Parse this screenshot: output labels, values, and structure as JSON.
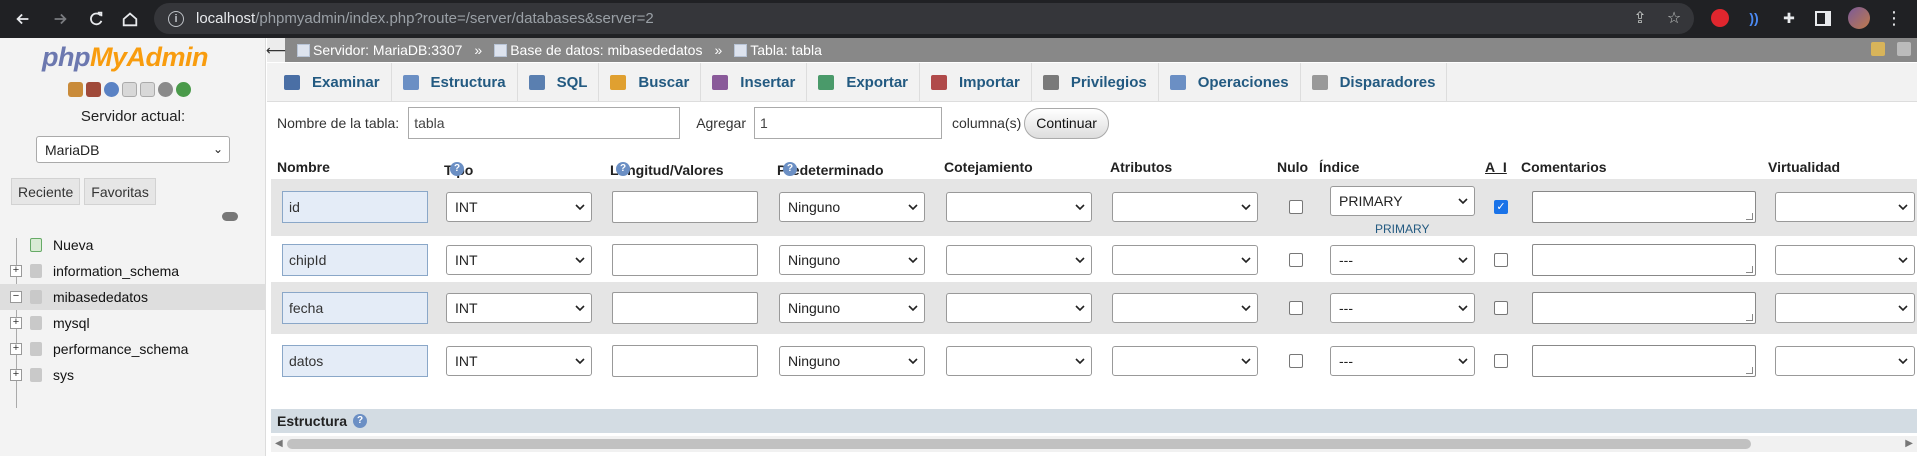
{
  "browser": {
    "url_host": "localhost",
    "url_path": "/phpmyadmin/index.php?route=/server/databases&server=2"
  },
  "sidebar": {
    "logo_php": "php",
    "logo_my": "MyAdmin",
    "server_label": "Servidor actual:",
    "server_selected": "MariaDB",
    "recent_label": "Reciente",
    "favorites_label": "Favoritas",
    "tree": [
      {
        "label": "Nueva",
        "type": "new"
      },
      {
        "label": "information_schema",
        "type": "db"
      },
      {
        "label": "mibasededatos",
        "type": "db",
        "selected": true
      },
      {
        "label": "mysql",
        "type": "db"
      },
      {
        "label": "performance_schema",
        "type": "db"
      },
      {
        "label": "sys",
        "type": "db"
      }
    ]
  },
  "breadcrumb": {
    "server": "Servidor: MariaDB:3307",
    "database": "Base de datos: mibasededatos",
    "table": "Tabla: tabla",
    "separator": "»"
  },
  "tabs": [
    {
      "label": "Examinar",
      "icon": "browse-icon",
      "color": "#4a6fa5"
    },
    {
      "label": "Estructura",
      "icon": "structure-icon",
      "color": "#6b8fc4"
    },
    {
      "label": "SQL",
      "icon": "sql-icon",
      "color": "#5a7fb0"
    },
    {
      "label": "Buscar",
      "icon": "search-icon",
      "color": "#e0a030"
    },
    {
      "label": "Insertar",
      "icon": "insert-icon",
      "color": "#8a5a9a"
    },
    {
      "label": "Exportar",
      "icon": "export-icon",
      "color": "#4a9a6a"
    },
    {
      "label": "Importar",
      "icon": "import-icon",
      "color": "#b04a4a"
    },
    {
      "label": "Privilegios",
      "icon": "privileges-icon",
      "color": "#7a7a7a"
    },
    {
      "label": "Operaciones",
      "icon": "operations-icon",
      "color": "#6b8fc4"
    },
    {
      "label": "Disparadores",
      "icon": "triggers-icon",
      "color": "#999999"
    }
  ],
  "form": {
    "table_name_label": "Nombre de la tabla:",
    "table_name_value": "tabla",
    "add_label": "Agregar",
    "add_value": "1",
    "columns_label": "columna(s)",
    "continue_button": "Continuar"
  },
  "columns_header": {
    "name": "Nombre",
    "type": "Tipo",
    "length": "Longitud/Valores",
    "default": "Predeterminado",
    "collation": "Cotejamiento",
    "attributes": "Atributos",
    "null": "Nulo",
    "index": "Índice",
    "ai": "A_I",
    "comments": "Comentarios",
    "virtuality": "Virtualidad"
  },
  "rows": [
    {
      "name": "id",
      "type": "INT",
      "default": "Ninguno",
      "index": "PRIMARY",
      "index_sub": "PRIMARY",
      "ai": true
    },
    {
      "name": "chipId",
      "type": "INT",
      "default": "Ninguno",
      "index": "---",
      "index_sub": "",
      "ai": false
    },
    {
      "name": "fecha",
      "type": "INT",
      "default": "Ninguno",
      "index": "---",
      "index_sub": "",
      "ai": false
    },
    {
      "name": "datos",
      "type": "INT",
      "default": "Ninguno",
      "index": "---",
      "index_sub": "",
      "ai": false
    }
  ],
  "structure_label": "Estructura"
}
